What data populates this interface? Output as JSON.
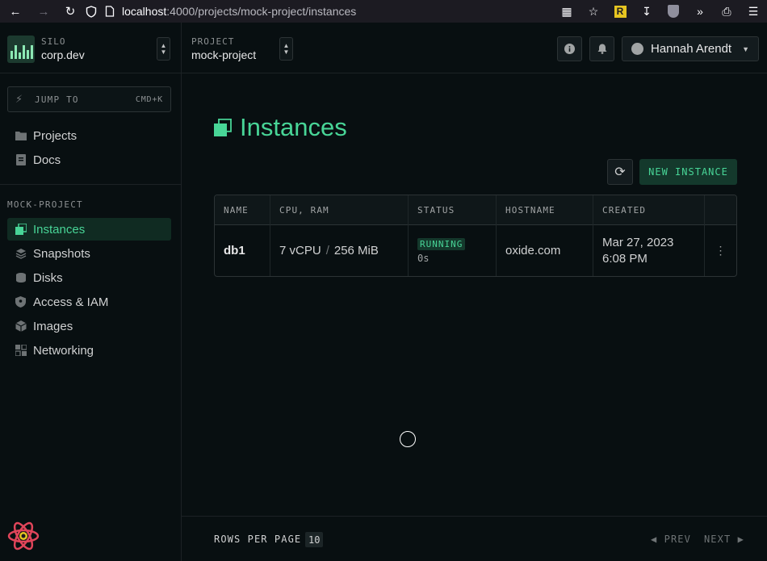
{
  "browser": {
    "url_host": "localhost",
    "url_path": ":4000/projects/mock-project/instances"
  },
  "silo": {
    "label": "SILO",
    "name": "corp.dev"
  },
  "jump": {
    "label": "JUMP TO",
    "shortcut": "CMD+K"
  },
  "global_nav": [
    {
      "label": "Projects",
      "icon": "folder-icon"
    },
    {
      "label": "Docs",
      "icon": "document-icon"
    }
  ],
  "project_nav": {
    "section_label": "MOCK-PROJECT",
    "items": [
      {
        "label": "Instances",
        "icon": "instances-icon",
        "active": true
      },
      {
        "label": "Snapshots",
        "icon": "snapshots-icon"
      },
      {
        "label": "Disks",
        "icon": "disk-icon"
      },
      {
        "label": "Access & IAM",
        "icon": "shield-icon"
      },
      {
        "label": "Images",
        "icon": "image-cube-icon"
      },
      {
        "label": "Networking",
        "icon": "networking-icon"
      }
    ]
  },
  "topbar": {
    "project_label": "PROJECT",
    "project_name": "mock-project",
    "user_name": "Hannah Arendt"
  },
  "page": {
    "title": "Instances",
    "new_button": "NEW INSTANCE"
  },
  "table": {
    "columns": [
      "NAME",
      "CPU, RAM",
      "STATUS",
      "HOSTNAME",
      "CREATED"
    ],
    "rows": [
      {
        "name": "db1",
        "cpu": "7 vCPU",
        "sep": "/",
        "ram": "256 MiB",
        "status": "RUNNING",
        "status_time": "0s",
        "hostname": "oxide.com",
        "created_date": "Mar 27, 2023",
        "created_time": "6:08 PM"
      }
    ]
  },
  "footer": {
    "rows_per_page_label": "ROWS PER PAGE",
    "rows_per_page_value": "10",
    "prev": "PREV",
    "next": "NEXT"
  },
  "colors": {
    "accent": "#48d597",
    "background": "#080f11"
  }
}
